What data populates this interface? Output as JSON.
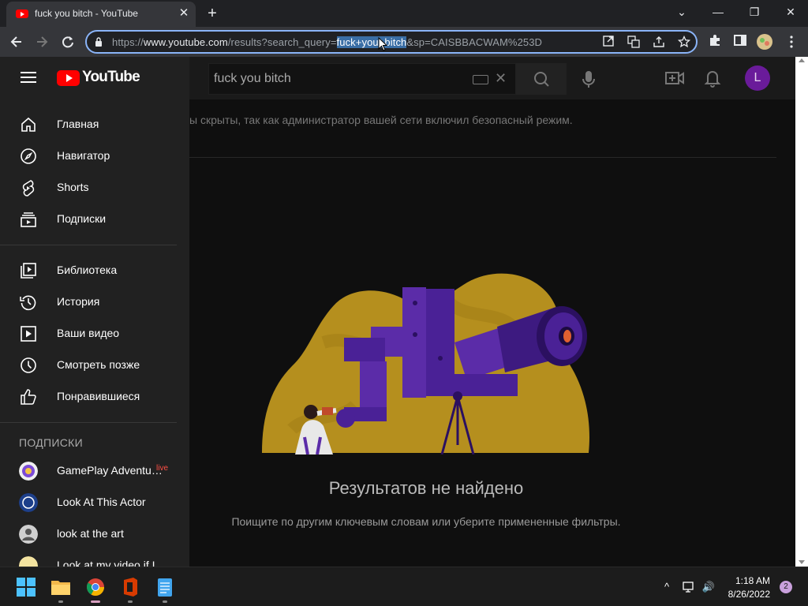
{
  "browser": {
    "tab_title": "fuck you bitch - YouTube",
    "tab_close": "✕",
    "new_tab": "+",
    "url_scheme": "https://",
    "url_host": "www.youtube.com",
    "url_path_pre": "/results?search_query=",
    "url_query_selected": "fuck+you+bitch",
    "url_path_post": "&sp=CAISBBACWAM%253D",
    "window_controls": {
      "minimize": "—",
      "restore": "❐",
      "close": "✕",
      "tab_list": "⌄"
    }
  },
  "youtube": {
    "logo_text": "YouTube",
    "search": {
      "value": "fuck you bitch",
      "clear": "✕"
    },
    "avatar_letter": "L",
    "notice": "ы скрыты, так как администратор вашей сети включил безопасный режим.",
    "no_results_title": "Результатов не найдено",
    "no_results_hint": "Поищите по другим ключевым словам или уберите примененные фильтры.",
    "sidebar": {
      "main": [
        {
          "label": "Главная",
          "icon": "home-icon"
        },
        {
          "label": "Навигатор",
          "icon": "compass-icon"
        },
        {
          "label": "Shorts",
          "icon": "shorts-icon"
        },
        {
          "label": "Подписки",
          "icon": "subscriptions-icon"
        }
      ],
      "library": [
        {
          "label": "Библиотека",
          "icon": "library-icon"
        },
        {
          "label": "История",
          "icon": "history-icon"
        },
        {
          "label": "Ваши видео",
          "icon": "your-videos-icon"
        },
        {
          "label": "Смотреть позже",
          "icon": "watch-later-icon"
        },
        {
          "label": "Понравившиеся",
          "icon": "thumbs-up-icon"
        }
      ],
      "subscriptions_title": "ПОДПИСКИ",
      "subscriptions": [
        {
          "label": "GamePlay Adventu…",
          "live": "live"
        },
        {
          "label": "Look At This Actor"
        },
        {
          "label": "look at the art"
        },
        {
          "label": "Look at my video if I"
        }
      ]
    }
  },
  "taskbar": {
    "time": "1:18 AM",
    "date": "8/26/2022",
    "notifications": "2",
    "tray_chevron": "^",
    "tray_volume": "🔊"
  },
  "colors": {
    "accent_blue": "#8ab4f8",
    "youtube_red": "#ff0000",
    "illustration_yellow": "#c9a227",
    "illustration_purple": "#5b2ca8"
  }
}
